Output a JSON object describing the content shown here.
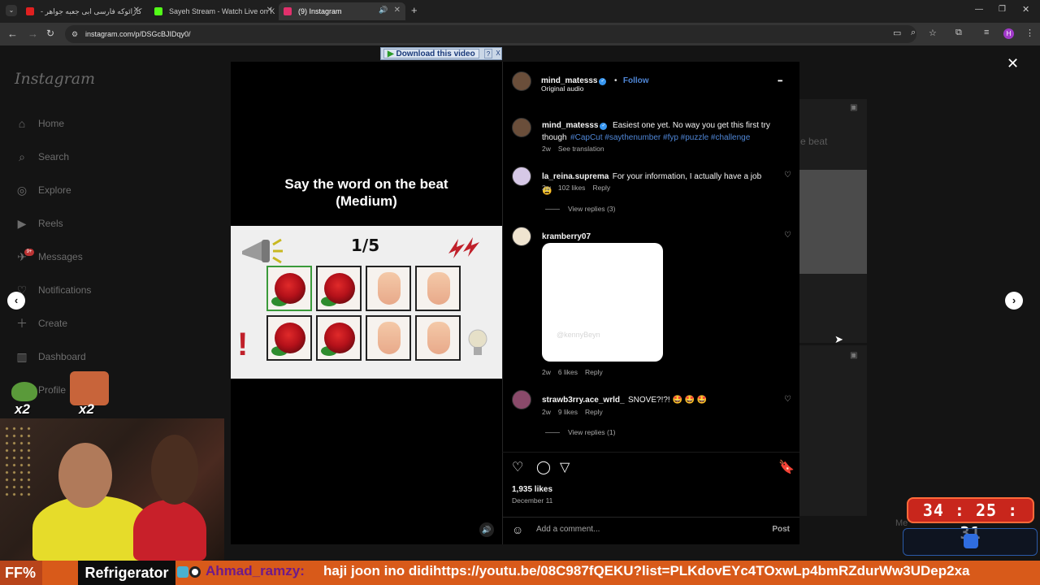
{
  "browser": {
    "tabs": [
      {
        "title": "کارائوکه فارسی ابی جعبه جواهر -",
        "icon_color": "#e02020"
      },
      {
        "title": "Sayeh Stream - Watch Live on K",
        "icon_color": "#53fc18"
      },
      {
        "title": "(9) Instagram",
        "icon_color": "#e1306c"
      }
    ],
    "url": "instagram.com/p/DSGcBJIDqy0/",
    "profile_initial": "H"
  },
  "download_bar": {
    "label": "Download this video",
    "help": "?",
    "close": "X"
  },
  "instagram": {
    "logo": "Instagram",
    "sidebar": [
      {
        "label": "Home",
        "icon": "home-icon"
      },
      {
        "label": "Search",
        "icon": "search-icon"
      },
      {
        "label": "Explore",
        "icon": "explore-icon"
      },
      {
        "label": "Reels",
        "icon": "reels-icon"
      },
      {
        "label": "Messages",
        "icon": "messages-icon"
      },
      {
        "label": "Notifications",
        "icon": "heart-icon"
      },
      {
        "label": "Create",
        "icon": "plus-icon"
      },
      {
        "label": "Dashboard",
        "icon": "dashboard-icon"
      },
      {
        "label": "Profile",
        "icon": "profile-icon"
      }
    ],
    "messages_badge": "9+",
    "bg_text_beat": "e beat",
    "bg_messages": "Me"
  },
  "video": {
    "title_line1": "Say the word on the beat",
    "title_line2": "(Medium)",
    "counter": "1/5"
  },
  "post": {
    "author": "mind_matesss",
    "follow": "Follow",
    "separator": "•",
    "audio": "Original audio",
    "more": "•••",
    "caption": {
      "user": "mind_matesss",
      "text": "Easiest one yet. No way you get this first try though",
      "hashtags": "#CapCut #saythenumber #fyp #puzzle #challenge",
      "age": "2w",
      "translate": "See translation"
    },
    "comments": [
      {
        "user": "la_reina.suprema",
        "text": "For your information, I actually have a job 😩",
        "age": "2w",
        "likes": "102 likes",
        "reply": "Reply",
        "view_replies": "View replies (3)"
      },
      {
        "user": "kramberry07",
        "text": "",
        "age": "2w",
        "likes": "6 likes",
        "reply": "Reply",
        "sticker_watermark": "@kennyBeyn"
      },
      {
        "user": "strawb3rry.ace_wrld_",
        "text": "SNOVE?!?! 🤩 🤩 🤩",
        "age": "2w",
        "likes": "9 likes",
        "reply": "Reply",
        "view_replies": "View replies (1)"
      }
    ],
    "likes": "1,935 likes",
    "date": "December 11",
    "add_comment_placeholder": "Add a comment...",
    "post_button": "Post"
  },
  "stream_overlay": {
    "timer": "34 : 25 : 31",
    "ticker_left": "FF%",
    "ticker_label": "Refrigerator",
    "ticker_user": "Ahmad_ramzy:",
    "ticker_message": "haji joon ino didihttps://youtu.be/08C987fQEKU?list=PLKdovEYc4TOxwLp4bmRZdurWw3UDep2xa",
    "multiplier_1": "x2",
    "multiplier_2": "x2"
  },
  "colors": {
    "accent_blue": "#4f86d6",
    "timer_red": "#c8261c",
    "ticker_orange": "#d85a1a"
  }
}
